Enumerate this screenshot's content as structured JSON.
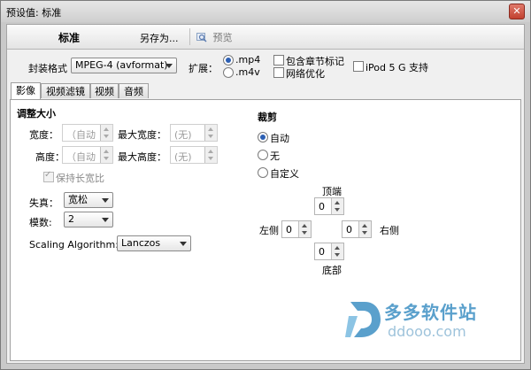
{
  "window": {
    "title": "预设值: 标准",
    "close_glyph": "✕"
  },
  "toolbar": {
    "preset_name": "标准",
    "save_as": "另存为...",
    "preview": "预览"
  },
  "container": {
    "label": "封装格式",
    "value": "MPEG-4 (avformat)",
    "extension_label": "扩展：",
    "extensions": [
      {
        "label": ".mp4",
        "selected": true
      },
      {
        "label": ".m4v",
        "selected": false
      }
    ],
    "options": [
      {
        "label": "包含章节标记",
        "checked": false
      },
      {
        "label": "网络优化",
        "checked": false
      },
      {
        "label": "iPod 5 G 支持",
        "checked": false
      }
    ]
  },
  "tabs": [
    {
      "label": "影像",
      "active": true
    },
    {
      "label": "视频滤镜",
      "active": false
    },
    {
      "label": "视频",
      "active": false
    },
    {
      "label": "音频",
      "active": false
    }
  ],
  "size": {
    "heading": "调整大小",
    "width_label": "宽度：",
    "width_value": "（自动",
    "max_width_label": "最大宽度：",
    "max_width_value": "(无)",
    "height_label": "高度：",
    "height_value": "（自动",
    "max_height_label": "最大高度：",
    "max_height_value": "(无)",
    "keep_aspect_label": "保持长宽比",
    "keep_aspect_checked": true,
    "anamorphic_label": "失真：",
    "anamorphic_value": "宽松",
    "modulus_label": "模数:",
    "modulus_value": "2",
    "scaling_label": "Scaling Algorithm:",
    "scaling_value": "Lanczos"
  },
  "crop": {
    "heading": "裁剪",
    "modes": [
      {
        "label": "自动",
        "selected": true
      },
      {
        "label": "无",
        "selected": false
      },
      {
        "label": "自定义",
        "selected": false
      }
    ],
    "top_label": "顶端",
    "top_value": "0",
    "left_label": "左侧",
    "left_value": "0",
    "right_label": "右侧",
    "right_value": "0",
    "bottom_label": "底部",
    "bottom_value": "0"
  },
  "watermark": {
    "cn": "多多软件站",
    "en": "ddooo.com"
  },
  "colors": {
    "accent": "#2c5fb3",
    "watermark": "#5aa0cc"
  }
}
